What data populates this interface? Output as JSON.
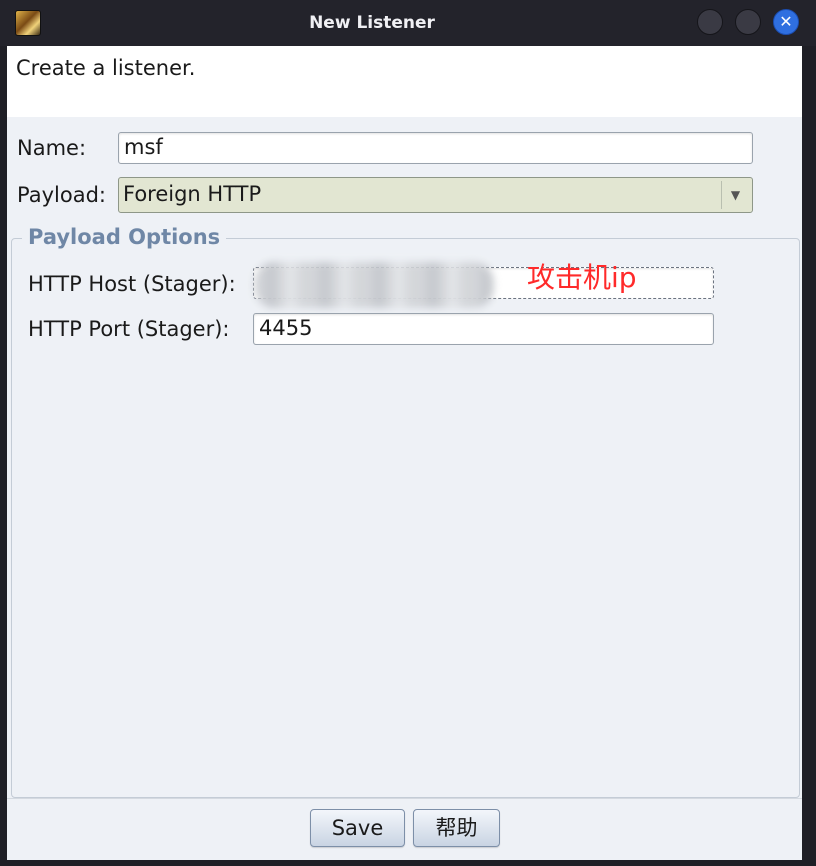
{
  "window": {
    "title": "New Listener"
  },
  "header": {
    "description": "Create a listener."
  },
  "form": {
    "name_label": "Name:",
    "name_value": "msf",
    "payload_label": "Payload:",
    "payload_value": "Foreign HTTP"
  },
  "payload_options": {
    "group_title": "Payload Options",
    "http_host_label": "HTTP Host (Stager):",
    "http_host_value": "",
    "http_port_label": "HTTP Port (Stager):",
    "http_port_value": "4455"
  },
  "annotation": {
    "text": "攻击机ip",
    "color": "#ff2a2a"
  },
  "buttons": {
    "save_label": "Save",
    "help_label": "帮助"
  },
  "icons": {
    "app": "app-icon",
    "dropdown": "chevron-down-icon",
    "close": "close-icon"
  },
  "colors": {
    "title_bar": "#23232b",
    "content_bg": "#eef1f6",
    "group_title": "#6f87a6",
    "close_button": "#2f6fe0"
  }
}
